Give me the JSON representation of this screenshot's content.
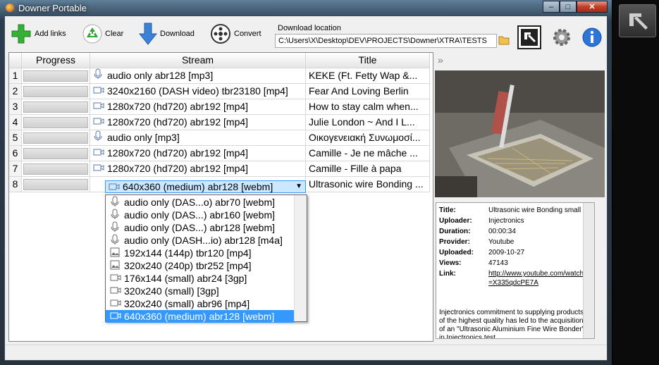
{
  "window": {
    "title": "Downer Portable",
    "min": "‒",
    "max": "□",
    "close": "✕"
  },
  "toolbar": {
    "add_links": "Add links",
    "clear": "Clear",
    "download": "Download",
    "convert": "Convert",
    "download_location_label": "Download location",
    "download_location_value": "C:\\Users\\X\\Desktop\\DEV\\PROJECTS\\Downer\\XTRA\\TESTS"
  },
  "grid": {
    "columns": [
      "Progress",
      "Stream",
      "Title"
    ],
    "rows": [
      {
        "num": "1",
        "stream_icon": "microphone-icon",
        "stream": "audio only abr128 [mp3]",
        "title": "KEKE (Ft. Fetty Wap &..."
      },
      {
        "num": "2",
        "stream_icon": "video-camera-icon",
        "stream": "3240x2160 (DASH video) tbr23180 [mp4]",
        "title": "Fear And Loving Berlin"
      },
      {
        "num": "3",
        "stream_icon": "video-camera-icon",
        "stream": "1280x720 (hd720) abr192 [mp4]",
        "title": "How to stay calm when..."
      },
      {
        "num": "4",
        "stream_icon": "video-camera-icon",
        "stream": "1280x720 (hd720) abr192 [mp4]",
        "title": "Julie London ~ And I L..."
      },
      {
        "num": "5",
        "stream_icon": "microphone-icon",
        "stream": "audio only [mp3]",
        "title": "Οικογενειακή Συνωμοσί..."
      },
      {
        "num": "6",
        "stream_icon": "video-camera-icon",
        "stream": "1280x720 (hd720) abr192 [mp4]",
        "title": "Camille - Je ne mâche ..."
      },
      {
        "num": "7",
        "stream_icon": "video-camera-icon",
        "stream": "1280x720 (hd720) abr192 [mp4]",
        "title": "Camille - Fille à papa"
      },
      {
        "num": "8",
        "stream_icon": "video-camera-icon",
        "stream": "640x360 (medium) abr128 [webm]",
        "title": "Ultrasonic wire Bonding ..."
      }
    ]
  },
  "dropdown": {
    "items": [
      {
        "icon": "microphone-icon",
        "label": "audio only (DAS...o) abr70 [webm]"
      },
      {
        "icon": "microphone-icon",
        "label": "audio only (DAS...) abr160 [webm]"
      },
      {
        "icon": "microphone-icon",
        "label": "audio only (DAS...) abr128 [webm]"
      },
      {
        "icon": "microphone-icon",
        "label": "audio only (DASH...io) abr128 [m4a]"
      },
      {
        "icon": "image-icon",
        "label": "192x144 (144p) tbr120 [mp4]"
      },
      {
        "icon": "image-icon",
        "label": "320x240 (240p) tbr252 [mp4]"
      },
      {
        "icon": "video-camera-icon",
        "label": "176x144 (small) abr24 [3gp]"
      },
      {
        "icon": "video-camera-icon",
        "label": "320x240 (small) [3gp]"
      },
      {
        "icon": "video-camera-icon",
        "label": "320x240 (small) abr96 [mp4]"
      },
      {
        "icon": "video-camera-icon",
        "label": "640x360 (medium) abr128 [webm]"
      }
    ]
  },
  "info": {
    "title_k": "Title:",
    "title_v": "Ultrasonic wire Bonding small clip",
    "uploader_k": "Uploader:",
    "uploader_v": "Injectronics",
    "duration_k": "Duration:",
    "duration_v": "00:00:34",
    "provider_k": "Provider:",
    "provider_v": "Youtube",
    "uploaded_k": "Uploaded:",
    "uploaded_v": "2009-10-27",
    "views_k": "Views:",
    "views_v": "47143",
    "link_k": "Link:",
    "link_v": "http://www.youtube.com/watch?v=X335qdcPE7A",
    "description": "Injectronics commitment to supplying products of the highest quality has led to the acquisition of an \"Ultrasonic Aluminium Fine Wire Bonder\" in Injectronics test"
  },
  "panel": {
    "expand_glyph": "»"
  }
}
